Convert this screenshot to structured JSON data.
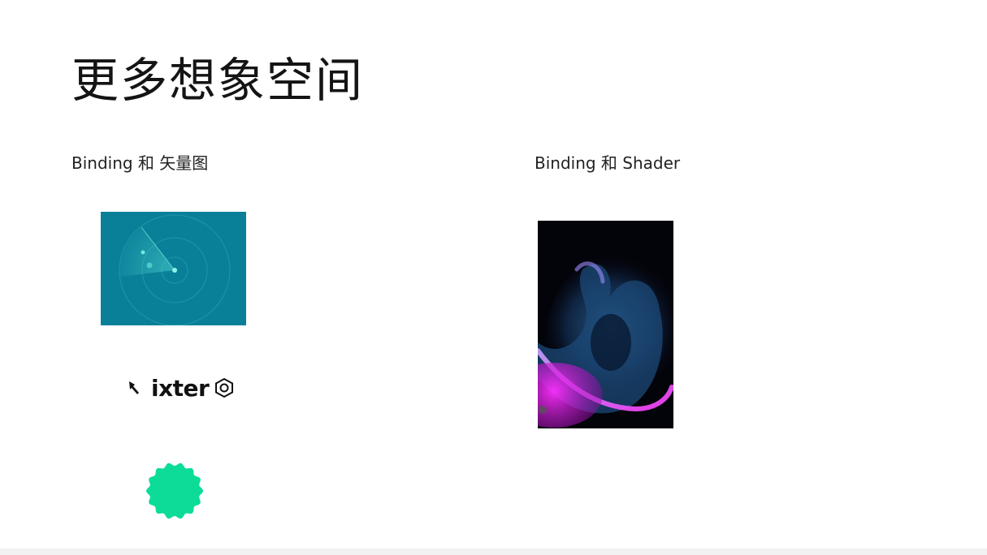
{
  "slide": {
    "title": "更多想象空间",
    "left_section": {
      "heading": "Binding 和 矢量图",
      "logo_text": "ixter"
    },
    "right_section": {
      "heading": "Binding 和 Shader"
    }
  },
  "colors": {
    "radar_bg": "#0a7f98",
    "blob_green": "#0ddc99",
    "shader_magenta": "#e020e0",
    "shader_blue": "#3a80b8"
  },
  "icons": [
    "radar-graphic",
    "pointer-icon",
    "hexagon-icon",
    "wavy-blob-shape",
    "shader-flame-graphic"
  ]
}
